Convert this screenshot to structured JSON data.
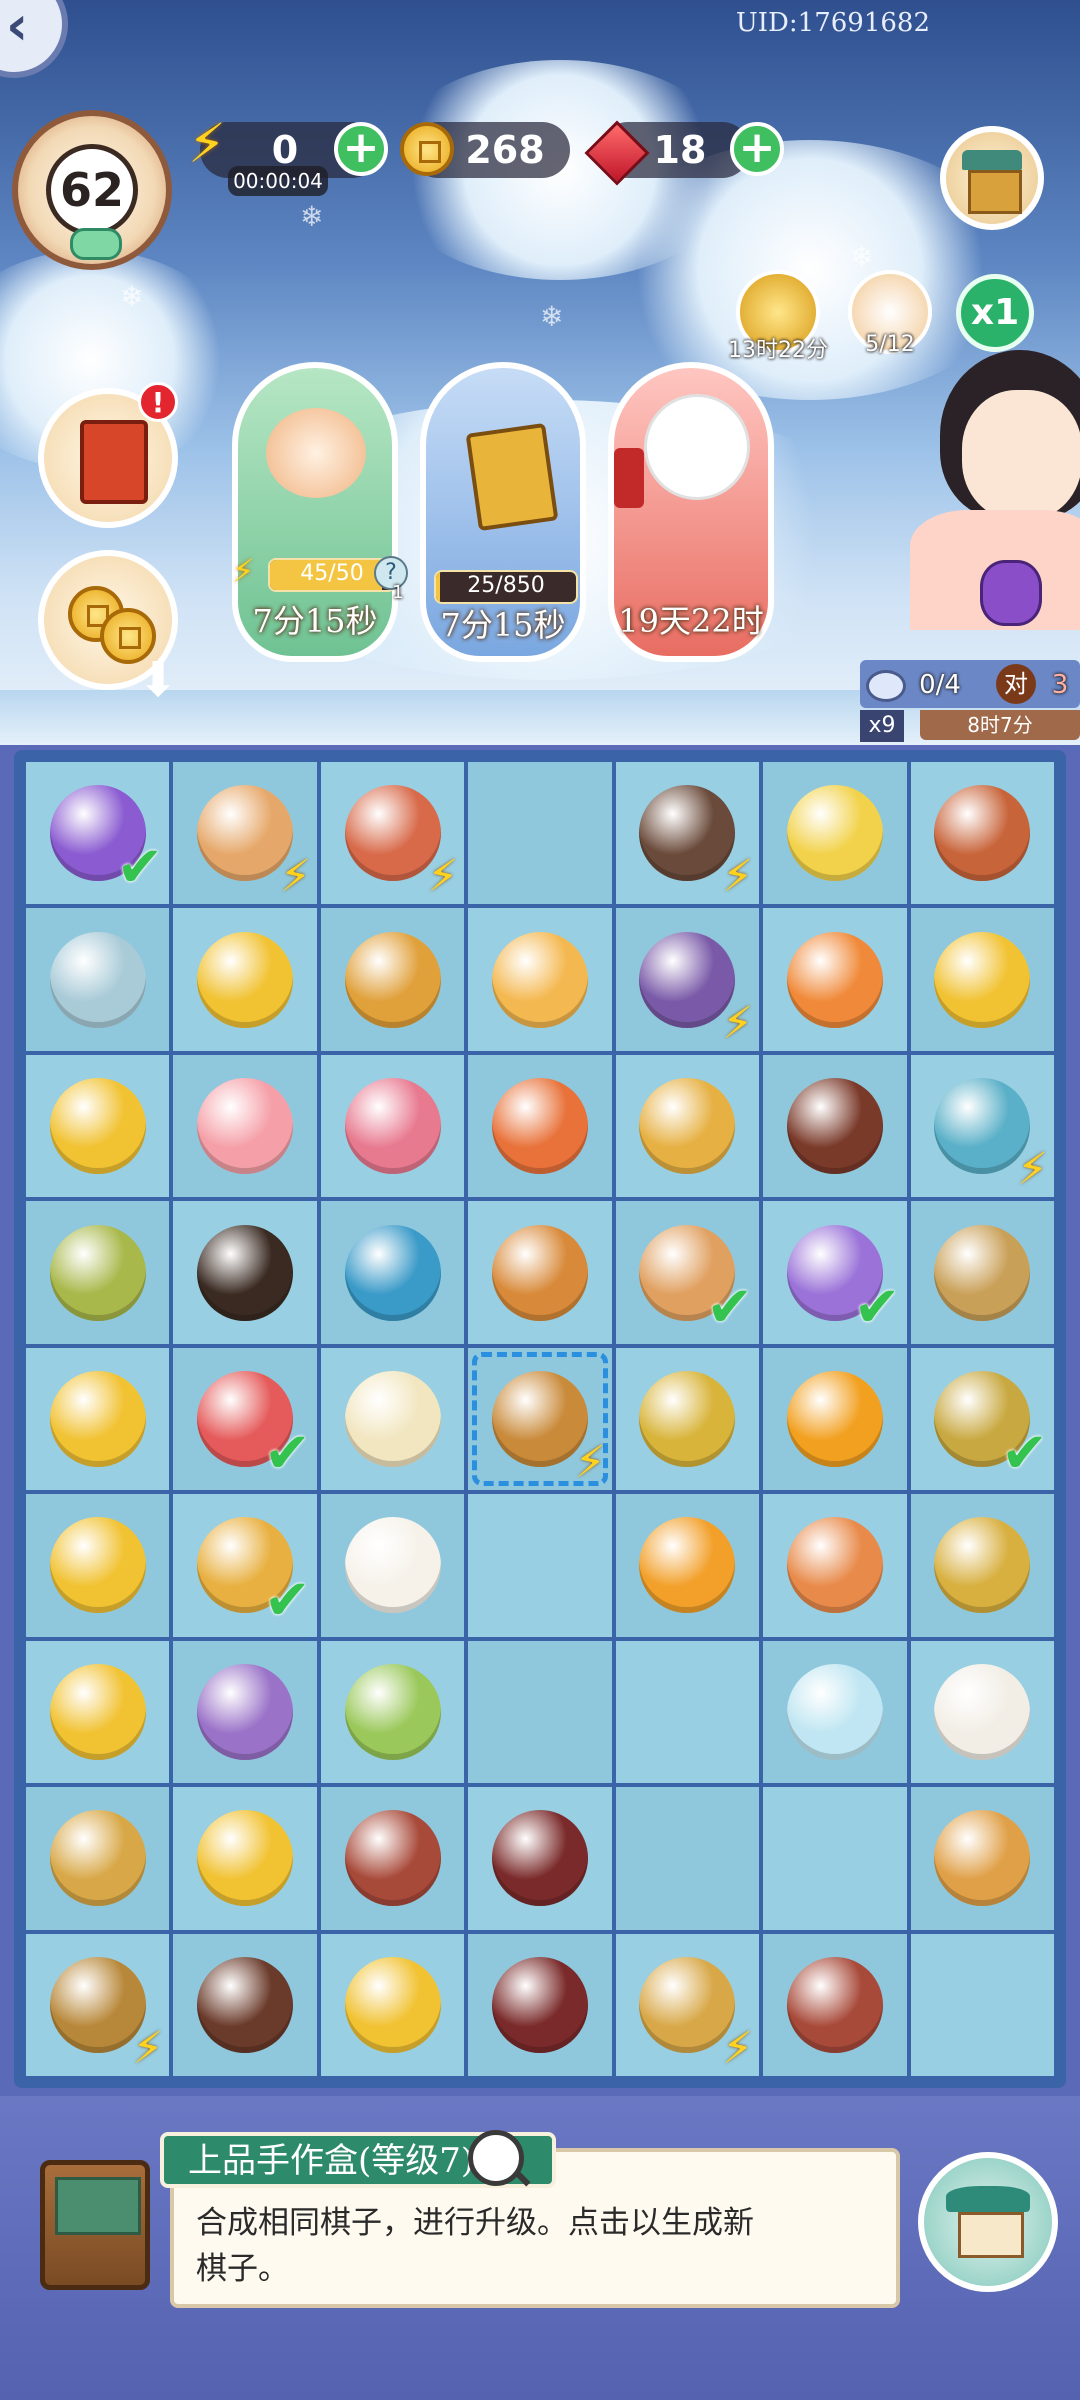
{
  "header": {
    "uid": "UID:17691682",
    "level": "62",
    "energy": "0",
    "energy_timer": "00:00:04",
    "coins": "268",
    "gems": "18",
    "event_timer": "13时22分",
    "cat_count": "5/12",
    "speed": "x1"
  },
  "cards": [
    {
      "progress_label": "45/50",
      "progress": 0.9,
      "time": "7分15秒",
      "hint": "1"
    },
    {
      "progress_label": "25/850",
      "progress": 0.03,
      "time": "7分15秒"
    },
    {
      "time": "19天22时"
    }
  ],
  "quest": {
    "count": "0/4",
    "badge": "对",
    "extra": "3",
    "multiplier": "x9",
    "timer": "8时7分"
  },
  "board": {
    "rows": [
      [
        {
          "icon": "purple-pouch-icon",
          "check": true
        },
        {
          "icon": "fruit-basket-icon",
          "zap": true
        },
        {
          "icon": "food-box-icon",
          "zap": true
        },
        {
          "icon": "empty"
        },
        {
          "icon": "treasure-chest-icon",
          "zap": true
        },
        {
          "icon": "chick-nest-icon"
        },
        {
          "icon": "chicken-coop-icon"
        }
      ],
      [
        {
          "icon": "jade-pendant-icon"
        },
        {
          "icon": "coin-stack-icon"
        },
        {
          "icon": "roast-chicken-icon"
        },
        {
          "icon": "egg-rice-icon"
        },
        {
          "icon": "water-mill-icon",
          "zap": true
        },
        {
          "icon": "lantern-icon"
        },
        {
          "icon": "coin-icon"
        }
      ],
      [
        {
          "icon": "coin-pile-icon"
        },
        {
          "icon": "pink-buns-icon"
        },
        {
          "icon": "flower-cakes-icon"
        },
        {
          "icon": "fruit-platter-icon"
        },
        {
          "icon": "hen-nest-icon"
        },
        {
          "icon": "bean-soup-icon"
        },
        {
          "icon": "teapot-icon",
          "zap": true
        }
      ],
      [
        {
          "icon": "woven-basket-icon"
        },
        {
          "icon": "calico-cat-icon"
        },
        {
          "icon": "tea-jar-icon"
        },
        {
          "icon": "feast-bowl-icon"
        },
        {
          "icon": "dessert-bowl-icon",
          "check": true
        },
        {
          "icon": "lavender-pouch-icon",
          "check": true
        },
        {
          "icon": "tea-box-icon"
        }
      ],
      [
        {
          "icon": "coin-pile-icon"
        },
        {
          "icon": "red-bun-icon",
          "check": true
        },
        {
          "icon": "rice-porridge-icon"
        },
        {
          "icon": "craft-box-icon",
          "selected": true,
          "zap": true
        },
        {
          "icon": "fried-rice-icon"
        },
        {
          "icon": "egg-custard-icon"
        },
        {
          "icon": "sweet-soup-icon",
          "check": true
        }
      ],
      [
        {
          "icon": "coin-pile-icon"
        },
        {
          "icon": "tea-cup-icon",
          "check": true
        },
        {
          "icon": "cotton-bowl-icon"
        },
        {
          "icon": "empty"
        },
        {
          "icon": "orange-porcelain-icon"
        },
        {
          "icon": "egg-icon"
        },
        {
          "icon": "tea-leaves-icon"
        }
      ],
      [
        {
          "icon": "coin-pile-icon"
        },
        {
          "icon": "flower-mirror-icon"
        },
        {
          "icon": "bamboo-icon"
        },
        {
          "icon": "empty"
        },
        {
          "icon": "empty"
        },
        {
          "icon": "porcelain-bowl-icon"
        },
        {
          "icon": "cotton-flower-icon"
        }
      ],
      [
        {
          "icon": "brush-scroll-icon"
        },
        {
          "icon": "coin-pile-icon"
        },
        {
          "icon": "bird-nest-icon"
        },
        {
          "icon": "wood-box-icon"
        },
        {
          "icon": "empty"
        },
        {
          "icon": "empty"
        },
        {
          "icon": "brush-ruler-icon"
        }
      ],
      [
        {
          "icon": "yarn-basket-icon",
          "zap": true
        },
        {
          "icon": "locked-chest-icon"
        },
        {
          "icon": "coin-pile-icon"
        },
        {
          "icon": "ink-tray-icon"
        },
        {
          "icon": "scroll-box-icon",
          "zap": true
        },
        {
          "icon": "egg-nest-icon"
        },
        {
          "icon": "empty"
        }
      ]
    ]
  },
  "info": {
    "title": "上品手作盒(等级7)",
    "description_line1": "合成相同棋子，进行升级。点击以生成新",
    "description_line2": "棋子。"
  },
  "colors": {
    "accent_green": "#2d8a6a",
    "board_bg": "#8fc8dc",
    "check_green": "#35c34f",
    "energy_yellow": "#ffd21f"
  }
}
